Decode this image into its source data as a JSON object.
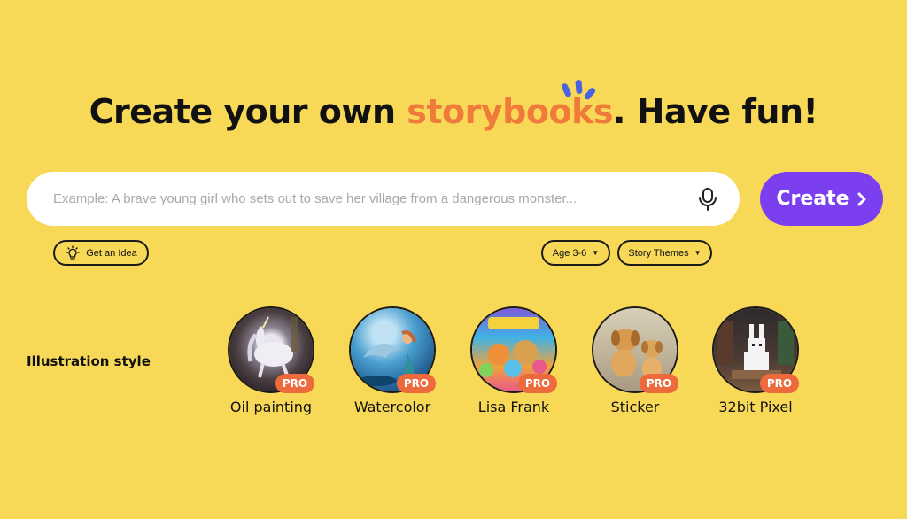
{
  "headline": {
    "part1": "Create your own ",
    "accent": "storybooks",
    "part2": ". Have fun!"
  },
  "search": {
    "placeholder": "Example: A brave young girl who sets out to save her village from a dangerous monster...",
    "mic_icon": "microphone-icon"
  },
  "create_button": {
    "label": "Create",
    "icon": "chevron-right-icon"
  },
  "options": {
    "idea_label": "Get an Idea",
    "idea_icon": "lightbulb-icon",
    "age_label": "Age 3-6",
    "themes_label": "Story Themes"
  },
  "illustration": {
    "label": "Illustration style",
    "badge": "PRO",
    "styles": [
      {
        "name": "Oil painting"
      },
      {
        "name": "Watercolor"
      },
      {
        "name": "Lisa Frank"
      },
      {
        "name": "Sticker"
      },
      {
        "name": "32bit Pixel"
      }
    ]
  },
  "colors": {
    "background": "#F8D957",
    "accent": "#F07A3A",
    "create_button": "#7B3FF0",
    "pro_badge": "#EC6A3C"
  }
}
